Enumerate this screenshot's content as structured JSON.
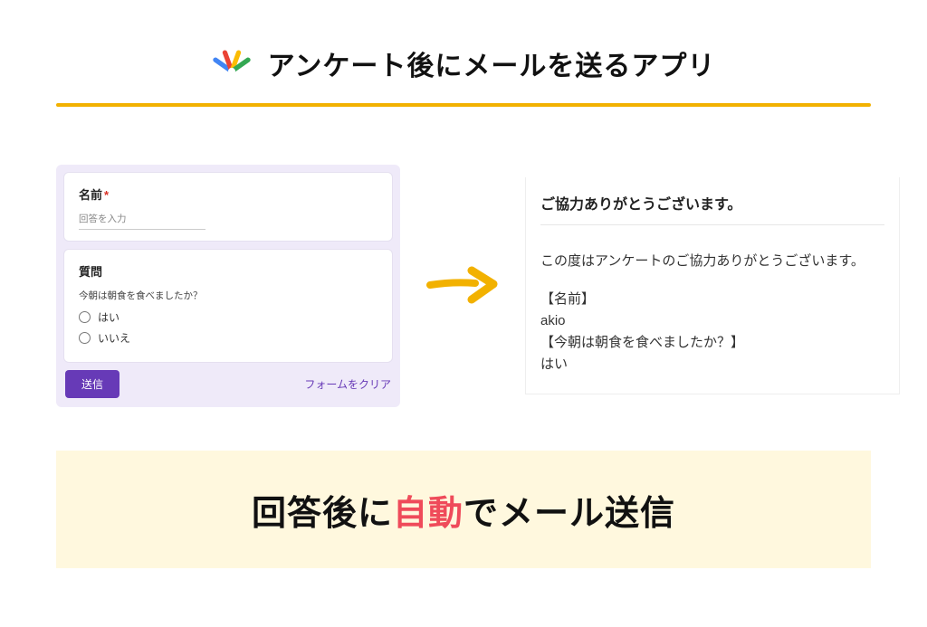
{
  "header": {
    "title": "アンケート後にメールを送るアプリ"
  },
  "form": {
    "name_field": {
      "label": "名前",
      "required_mark": "*",
      "placeholder": "回答を入力"
    },
    "question_field": {
      "label": "質問",
      "subtitle": "今朝は朝食を食べましたか？",
      "options": [
        "はい",
        "いいえ"
      ]
    },
    "submit_label": "送信",
    "clear_label": "フォームをクリア"
  },
  "email": {
    "subject": "ご協力ありがとうございます。",
    "body_intro": "この度はアンケートのご協力ありがとうございます。",
    "name_header": "【名前】",
    "name_value": "akio",
    "answer_header": "【今朝は朝食を食べましたか？】",
    "answer_value": "はい"
  },
  "banner": {
    "part1": "回答後に",
    "accent": "自動",
    "part2": "でメール送信"
  }
}
